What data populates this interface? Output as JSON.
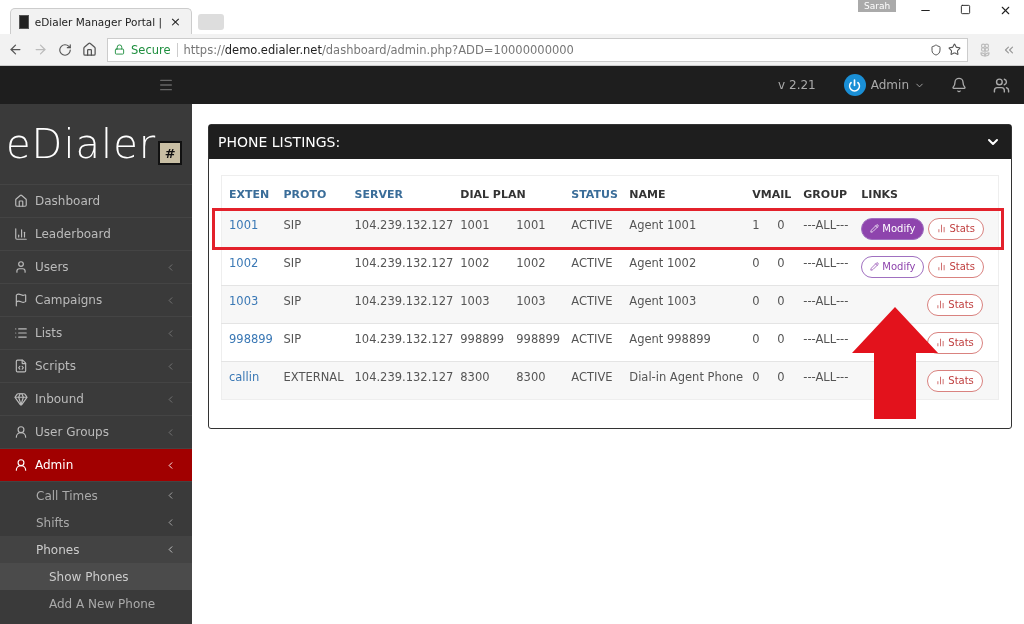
{
  "browser": {
    "tab_title": "eDialer Manager Portal |",
    "tab_close": "×",
    "profile": "Sarah",
    "secure_label": "Secure",
    "url": "https://**demo.edialer.net**/dashboard/admin.php?ADD=10000000000"
  },
  "topbar": {
    "version": "v 2.21",
    "user": "Admin"
  },
  "sidebar": {
    "logo": "eDialer",
    "logo_mark": "#",
    "items": [
      {
        "label": "Dashboard",
        "selected": false,
        "caret": false
      },
      {
        "label": "Leaderboard",
        "selected": false,
        "caret": false
      },
      {
        "label": "Users",
        "selected": false,
        "caret": true
      },
      {
        "label": "Campaigns",
        "selected": false,
        "caret": true
      },
      {
        "label": "Lists",
        "selected": false,
        "caret": true
      },
      {
        "label": "Scripts",
        "selected": false,
        "caret": true
      },
      {
        "label": "Inbound",
        "selected": false,
        "caret": true
      },
      {
        "label": "User Groups",
        "selected": false,
        "caret": true
      },
      {
        "label": "Admin",
        "selected": true,
        "caret": true,
        "children": [
          {
            "label": "Call Times",
            "selected": false,
            "caret": true
          },
          {
            "label": "Shifts",
            "selected": false,
            "caret": true
          },
          {
            "label": "Phones",
            "selected": true,
            "caret": true,
            "children": [
              {
                "label": "Show Phones",
                "selected": true
              },
              {
                "label": "Add A New Phone",
                "selected": false
              }
            ]
          }
        ]
      }
    ]
  },
  "panel": {
    "title": "PHONE LISTINGS:",
    "columns": [
      {
        "label": "EXTEN",
        "sortable": true
      },
      {
        "label": "PROTO",
        "sortable": true
      },
      {
        "label": "SERVER",
        "sortable": true
      },
      {
        "label": "DIAL PLAN",
        "sortable": false
      },
      {
        "label": "STATUS",
        "sortable": true
      },
      {
        "label": "NAME",
        "sortable": false
      },
      {
        "label": "VMAIL",
        "sortable": false
      },
      {
        "label": "GROUP",
        "sortable": false
      },
      {
        "label": "LINKS",
        "sortable": false
      }
    ],
    "rows": [
      {
        "exten": "1001",
        "proto": "SIP",
        "server": "104.239.132.127",
        "dial_plan": [
          "1001",
          "1001"
        ],
        "status": "ACTIVE",
        "name": "Agent 1001",
        "vmail": [
          "1",
          "0"
        ],
        "group": "---ALL---",
        "modify": {
          "label": "Modify",
          "active": true
        },
        "stats": "Stats",
        "highlighted": true
      },
      {
        "exten": "1002",
        "proto": "SIP",
        "server": "104.239.132.127",
        "dial_plan": [
          "1002",
          "1002"
        ],
        "status": "ACTIVE",
        "name": "Agent 1002",
        "vmail": [
          "0",
          "0"
        ],
        "group": "---ALL---",
        "modify": {
          "label": "Modify",
          "active": false
        },
        "stats": "Stats",
        "highlighted": false
      },
      {
        "exten": "1003",
        "proto": "SIP",
        "server": "104.239.132.127",
        "dial_plan": [
          "1003",
          "1003"
        ],
        "status": "ACTIVE",
        "name": "Agent 1003",
        "vmail": [
          "0",
          "0"
        ],
        "group": "---ALL---",
        "stats": "Stats",
        "highlighted": false
      },
      {
        "exten": "998899",
        "proto": "SIP",
        "server": "104.239.132.127",
        "dial_plan": [
          "998899",
          "998899"
        ],
        "status": "ACTIVE",
        "name": "Agent 998899",
        "vmail": [
          "0",
          "0"
        ],
        "group": "---ALL---",
        "stats": "Stats",
        "highlighted": false
      },
      {
        "exten": "callin",
        "proto": "EXTERNAL",
        "server": "104.239.132.127",
        "dial_plan": [
          "8300",
          "8300"
        ],
        "status": "ACTIVE",
        "name": "Dial-in Agent Phone",
        "vmail": [
          "0",
          "0"
        ],
        "group": "---ALL---",
        "stats": "Stats",
        "highlighted": false
      }
    ]
  }
}
